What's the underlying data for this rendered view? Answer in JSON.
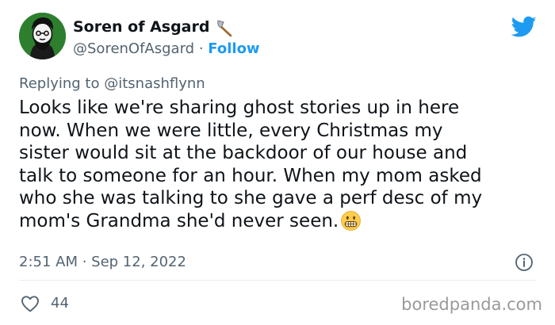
{
  "author": {
    "display_name": "Soren of Asgard",
    "handle": "@SorenOfAsgard",
    "separator": "·",
    "follow_label": "Follow",
    "avatar_icon": "illustrated-bearded-man-avatar",
    "name_icon": "axe-icon"
  },
  "platform_icon": "twitter-bird-icon",
  "reply": {
    "prefix": "Replying to",
    "handle": "@itsnashflynn"
  },
  "tweet": {
    "lines": [
      "Looks like we're sharing ghost stories up in here",
      "now. When we were little, every Christmas my",
      "sister would sit at the backdoor of our house and",
      "talk to someone for an hour. When my mom asked",
      "who she was talking to she gave a perf desc of my",
      "mom's Grandma she'd never seen."
    ],
    "trailing_emoji": "grimacing-face-icon"
  },
  "meta": {
    "timestamp": "2:51 AM · Sep 12, 2022",
    "info_icon": "info-icon"
  },
  "engagement": {
    "likes": "44",
    "like_icon": "heart-icon"
  },
  "watermark": "boredpanda.com",
  "colors": {
    "accent": "#1d9bf0",
    "text": "#0f1419",
    "secondary": "#536471",
    "avatar_bg": "#2d7f2e",
    "watermark": "#9a9a9a"
  }
}
